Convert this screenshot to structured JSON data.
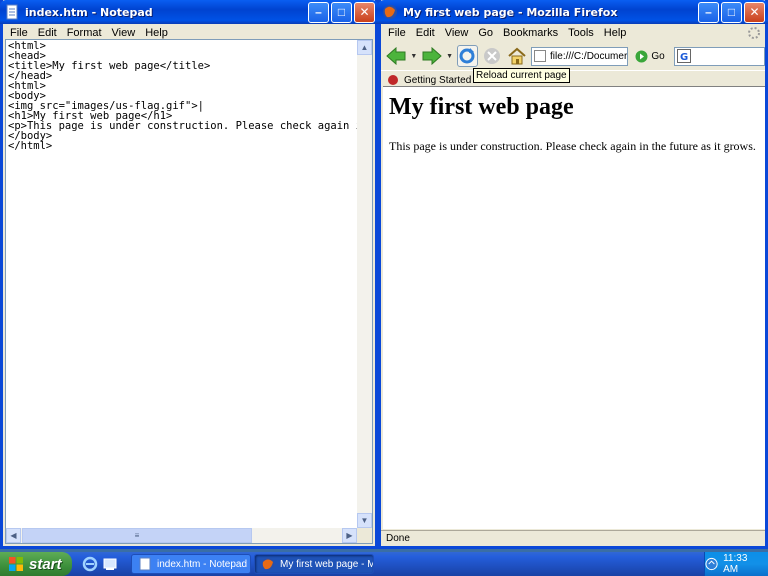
{
  "notepad": {
    "title": "index.htm - Notepad",
    "menu": [
      "File",
      "Edit",
      "Format",
      "View",
      "Help"
    ],
    "content": "<html>\n<head>\n<title>My first web page</title>\n</head>\n<html>\n<body>\n<img src=\"images/us-flag.gif\">|\n<h1>My first web page</h1>\n<p>This page is under construction. Please check again in t\n</body>\n</html>"
  },
  "firefox": {
    "title": "My first web page - Mozilla Firefox",
    "menu": [
      "File",
      "Edit",
      "View",
      "Go",
      "Bookmarks",
      "Tools",
      "Help"
    ],
    "url": "file:///C:/Documer",
    "go_label": "Go",
    "bookmark": "Getting Started",
    "tooltip": "Reload current page",
    "page_heading": "My first web page",
    "page_text": "This page is under construction. Please check again in the future as it grows.",
    "status": "Done"
  },
  "taskbar": {
    "start_label": "start",
    "tasks": [
      "index.htm - Notepad",
      "My first web page - M..."
    ],
    "clock": "11:33 AM"
  },
  "colors": {
    "title_blue": "#0a5ef2",
    "taskbar_blue": "#245edb",
    "start_green": "#3c8f3b",
    "tray_blue": "#0c8fe8"
  }
}
